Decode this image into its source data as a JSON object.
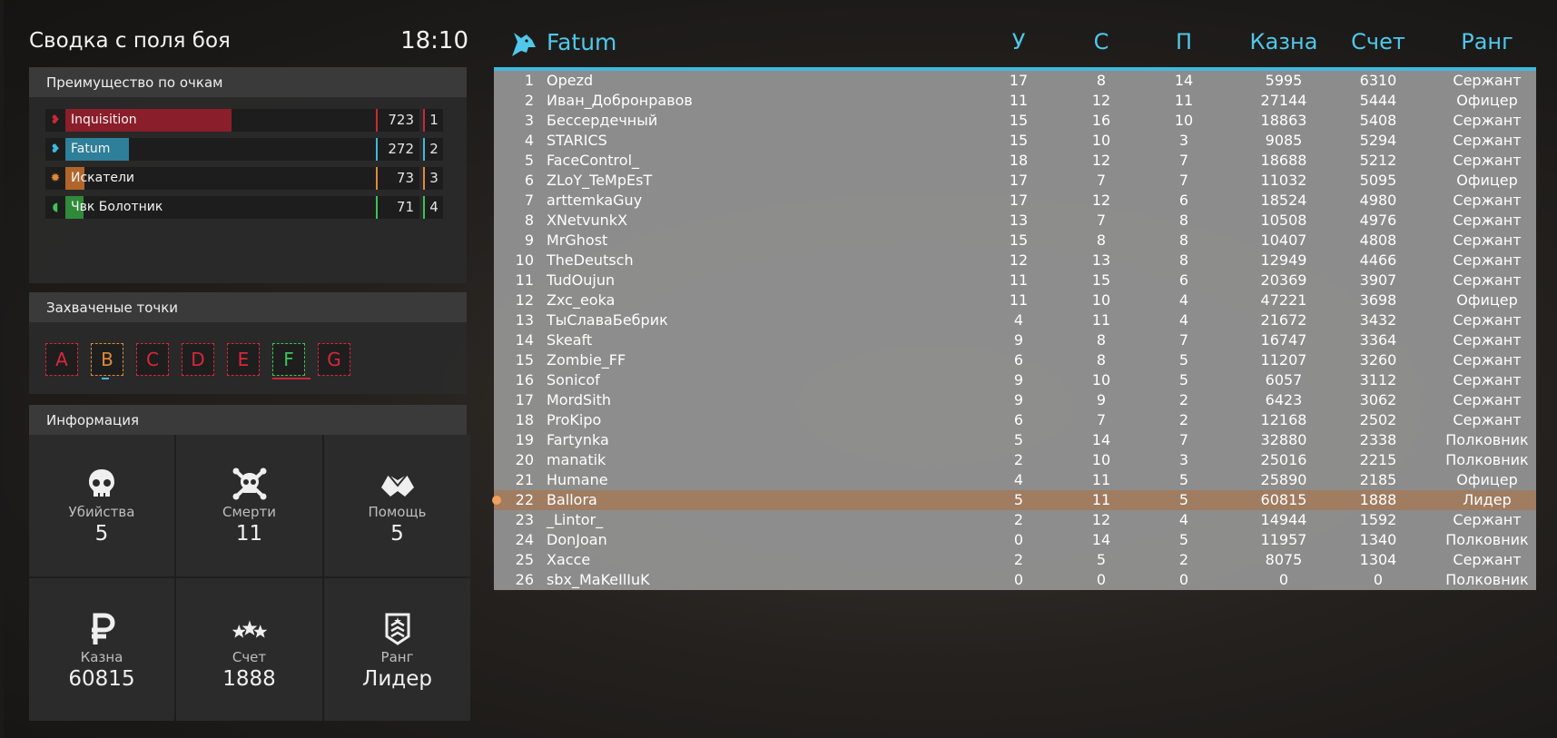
{
  "header": {
    "title": "Сводка с поля боя",
    "time": "18:10"
  },
  "score_panel": {
    "title": "Преимущество по очкам",
    "teams": [
      {
        "name": "Inquisition",
        "score": "723",
        "place": "1",
        "color": "#8a1e2a",
        "accent": "#c8283a",
        "fill": 0.535
      },
      {
        "name": "Fatum",
        "score": "272",
        "place": "2",
        "color": "#2e7f99",
        "accent": "#3fb9dd",
        "fill": 0.205
      },
      {
        "name": "Искатели",
        "score": "73",
        "place": "3",
        "color": "#b0662a",
        "accent": "#e08a3a",
        "fill": 0.06
      },
      {
        "name": "Чвк Болотник",
        "score": "71",
        "place": "4",
        "color": "#2f8a3a",
        "accent": "#3fc25a",
        "fill": 0.058
      }
    ]
  },
  "points_panel": {
    "title": "Захваченые точки",
    "points": [
      {
        "letter": "A",
        "color": "#d8283a"
      },
      {
        "letter": "B",
        "color": "#e08a3a"
      },
      {
        "letter": "C",
        "color": "#d8283a"
      },
      {
        "letter": "D",
        "color": "#d8283a"
      },
      {
        "letter": "E",
        "color": "#d8283a"
      },
      {
        "letter": "F",
        "color": "#3fc25a"
      },
      {
        "letter": "G",
        "color": "#d8283a"
      }
    ]
  },
  "info_panel": {
    "title": "Информация",
    "cells": [
      {
        "icon": "skull-icon",
        "label": "Убийства",
        "value": "5"
      },
      {
        "icon": "skull-crossbones-icon",
        "label": "Смерти",
        "value": "11"
      },
      {
        "icon": "handshake-icon",
        "label": "Помощь",
        "value": "5"
      },
      {
        "icon": "ruble-icon",
        "label": "Казна",
        "value": "60815"
      },
      {
        "icon": "stars-icon",
        "label": "Счет",
        "value": "1888"
      },
      {
        "icon": "rank-chevron-icon",
        "label": "Ранг",
        "value": "Лидер"
      }
    ]
  },
  "scoreboard": {
    "team_name": "Fatum",
    "team_color": "#4fc8ea",
    "columns": {
      "kills": "У",
      "deaths": "С",
      "assists": "П",
      "money": "Казна",
      "score": "Счет",
      "rank": "Ранг"
    },
    "rows": [
      {
        "num": "1",
        "name": "Opezd",
        "k": "17",
        "d": "8",
        "a": "14",
        "money": "5995",
        "score": "6310",
        "rank": "Сержант"
      },
      {
        "num": "2",
        "name": "Иван_Добронравов",
        "k": "11",
        "d": "12",
        "a": "11",
        "money": "27144",
        "score": "5444",
        "rank": "Офицер"
      },
      {
        "num": "3",
        "name": "Бессердечный",
        "k": "15",
        "d": "16",
        "a": "10",
        "money": "18863",
        "score": "5408",
        "rank": "Сержант"
      },
      {
        "num": "4",
        "name": "STARICS",
        "k": "15",
        "d": "10",
        "a": "3",
        "money": "9085",
        "score": "5294",
        "rank": "Сержант"
      },
      {
        "num": "5",
        "name": "FaceControl_",
        "k": "18",
        "d": "12",
        "a": "7",
        "money": "18688",
        "score": "5212",
        "rank": "Сержант"
      },
      {
        "num": "6",
        "name": "ZLoY_TeMpEsT",
        "k": "17",
        "d": "7",
        "a": "7",
        "money": "11032",
        "score": "5095",
        "rank": "Офицер"
      },
      {
        "num": "7",
        "name": "arttemkaGuy",
        "k": "17",
        "d": "12",
        "a": "6",
        "money": "18524",
        "score": "4980",
        "rank": "Сержант"
      },
      {
        "num": "8",
        "name": "XNetvunkX",
        "k": "13",
        "d": "7",
        "a": "8",
        "money": "10508",
        "score": "4976",
        "rank": "Сержант"
      },
      {
        "num": "9",
        "name": "MrGhost",
        "k": "15",
        "d": "8",
        "a": "8",
        "money": "10407",
        "score": "4808",
        "rank": "Сержант"
      },
      {
        "num": "10",
        "name": "TheDeutsch",
        "k": "12",
        "d": "13",
        "a": "8",
        "money": "12949",
        "score": "4466",
        "rank": "Сержант"
      },
      {
        "num": "11",
        "name": "TudOujun",
        "k": "11",
        "d": "15",
        "a": "6",
        "money": "20369",
        "score": "3907",
        "rank": "Сержант"
      },
      {
        "num": "12",
        "name": "Zxc_eoka",
        "k": "11",
        "d": "10",
        "a": "4",
        "money": "47221",
        "score": "3698",
        "rank": "Офицер"
      },
      {
        "num": "13",
        "name": "ТыСлаваБебрик",
        "k": "4",
        "d": "11",
        "a": "4",
        "money": "21672",
        "score": "3432",
        "rank": "Сержант"
      },
      {
        "num": "14",
        "name": "Skeaft",
        "k": "9",
        "d": "8",
        "a": "7",
        "money": "16747",
        "score": "3364",
        "rank": "Сержант"
      },
      {
        "num": "15",
        "name": "Zombie_FF",
        "k": "6",
        "d": "8",
        "a": "5",
        "money": "11207",
        "score": "3260",
        "rank": "Сержант"
      },
      {
        "num": "16",
        "name": "Sonicof",
        "k": "9",
        "d": "10",
        "a": "5",
        "money": "6057",
        "score": "3112",
        "rank": "Сержант"
      },
      {
        "num": "17",
        "name": "MordSith",
        "k": "9",
        "d": "9",
        "a": "2",
        "money": "6423",
        "score": "3062",
        "rank": "Сержант"
      },
      {
        "num": "18",
        "name": "ProKipo",
        "k": "6",
        "d": "7",
        "a": "2",
        "money": "12168",
        "score": "2502",
        "rank": "Сержант"
      },
      {
        "num": "19",
        "name": "Fartynka",
        "k": "5",
        "d": "14",
        "a": "7",
        "money": "32880",
        "score": "2338",
        "rank": "Полковник"
      },
      {
        "num": "20",
        "name": "manatik",
        "k": "2",
        "d": "10",
        "a": "3",
        "money": "25016",
        "score": "2215",
        "rank": "Полковник"
      },
      {
        "num": "21",
        "name": "Humane",
        "k": "4",
        "d": "11",
        "a": "5",
        "money": "25890",
        "score": "2185",
        "rank": "Офицер"
      },
      {
        "num": "22",
        "name": "Ballora",
        "k": "5",
        "d": "11",
        "a": "5",
        "money": "60815",
        "score": "1888",
        "rank": "Лидер",
        "me": true
      },
      {
        "num": "23",
        "name": "_Lintor_",
        "k": "2",
        "d": "12",
        "a": "4",
        "money": "14944",
        "score": "1592",
        "rank": "Сержант"
      },
      {
        "num": "24",
        "name": "DonJoan",
        "k": "0",
        "d": "14",
        "a": "5",
        "money": "11957",
        "score": "1340",
        "rank": "Полковник"
      },
      {
        "num": "25",
        "name": "Xacce",
        "k": "2",
        "d": "5",
        "a": "2",
        "money": "8075",
        "score": "1304",
        "rank": "Сержант"
      },
      {
        "num": "26",
        "name": "sbx_MaKeIlIuK",
        "k": "0",
        "d": "0",
        "a": "0",
        "money": "0",
        "score": "0",
        "rank": "Полковник"
      }
    ]
  }
}
